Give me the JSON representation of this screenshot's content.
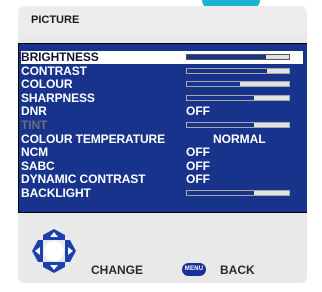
{
  "header": {
    "title": "PICTURE"
  },
  "menu": [
    {
      "label": "BRIGHTNESS",
      "type": "bar",
      "level": 0.77,
      "selected": true
    },
    {
      "label": "CONTRAST",
      "type": "bar",
      "level": 0.78
    },
    {
      "label": "COLOUR",
      "type": "bar",
      "level": 0.52
    },
    {
      "label": "SHARPNESS",
      "type": "bar",
      "level": 0.66
    },
    {
      "label": "DNR",
      "type": "value",
      "value": "OFF"
    },
    {
      "label": "TINT",
      "type": "bar",
      "level": 0.66,
      "disabled": true
    },
    {
      "label": "COLOUR TEMPERATURE",
      "type": "value",
      "value": "NORMAL"
    },
    {
      "label": "NCM",
      "type": "value",
      "value": "OFF"
    },
    {
      "label": "SABC",
      "type": "value",
      "value": "OFF"
    },
    {
      "label": "DYNAMIC CONTRAST",
      "type": "value",
      "value": "OFF"
    },
    {
      "label": "BACKLIGHT",
      "type": "bar",
      "level": 0.66
    }
  ],
  "footer": {
    "change_label": "CHANGE",
    "menu_button_label": "MENU",
    "back_label": "BACK"
  },
  "colors": {
    "panel": "#17338c",
    "accent": "#19b4d2",
    "selected_row": "#ffffff",
    "bar_track": "#e2e2e2",
    "dpad": "#1d3fae"
  },
  "icons": {
    "navigate": "dpad-icon",
    "menu": "menu-button-icon"
  }
}
